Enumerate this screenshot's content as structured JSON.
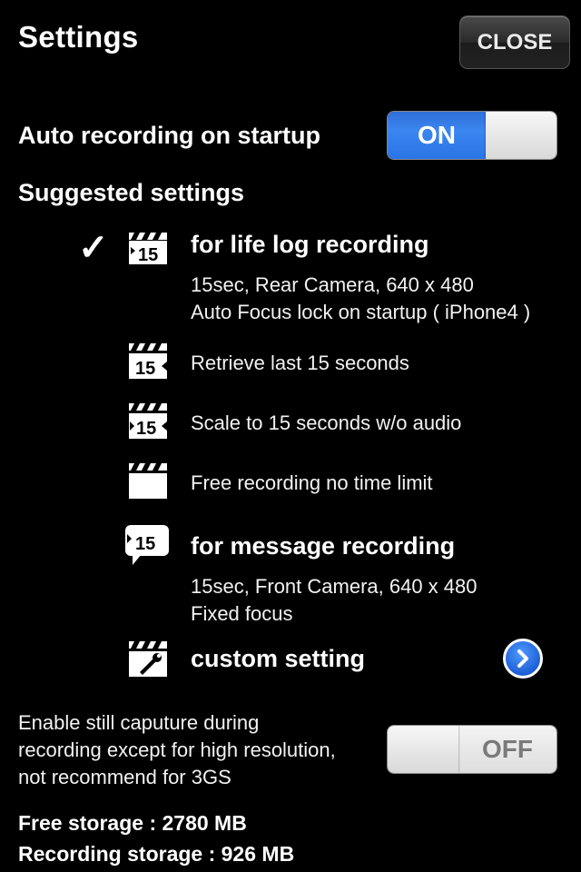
{
  "header": {
    "title": "Settings",
    "close_label": "CLOSE"
  },
  "auto_recording": {
    "label": "Auto recording on startup",
    "state": "ON"
  },
  "suggested": {
    "heading": "Suggested settings",
    "life_log": {
      "title": "for life log recording",
      "line1": "15sec, Rear Camera, 640 x 480",
      "line2": "Auto Focus lock on startup ( iPhone4 )",
      "icon_text": "15"
    },
    "retrieve": {
      "label": "Retrieve last 15 seconds",
      "icon_text": "15"
    },
    "scale": {
      "label": "Scale to 15 seconds w/o audio",
      "icon_text": "15"
    },
    "free": {
      "label": "Free recording no time limit"
    },
    "message": {
      "title": "for message recording",
      "line1": "15sec, Front Camera, 640 x 480",
      "line2": "Fixed focus",
      "icon_text": "15"
    },
    "custom": {
      "title": "custom setting"
    }
  },
  "still_capture": {
    "line1": "Enable still caputure during",
    "line2": "recording except for high resolution,",
    "line3": "not recommend for 3GS",
    "state": "OFF"
  },
  "storage": {
    "free": "Free storage : 2780 MB",
    "recording": "Recording storage : 926 MB"
  },
  "colors": {
    "toggle_on": "#2f78e6",
    "accent_button": "#1e5fd6"
  },
  "selected_preset": "life_log"
}
